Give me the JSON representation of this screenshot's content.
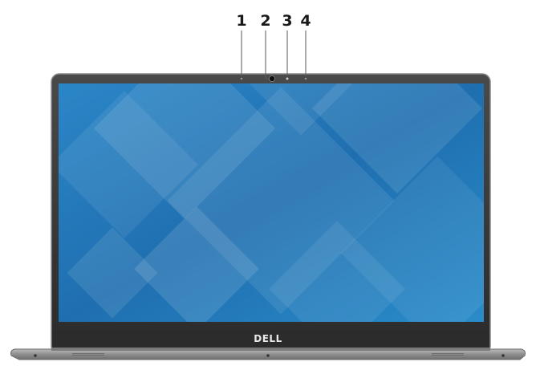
{
  "figure": {
    "title": "",
    "callouts": [
      {
        "number": "1"
      },
      {
        "number": "2"
      },
      {
        "number": "3"
      },
      {
        "number": "4"
      }
    ],
    "logo_text": "DELL"
  },
  "colors": {
    "bezel": "#3a3a3a",
    "screen_blue": "#1f7fc0",
    "base_silver": "#9a9a9a",
    "callout_line": "#5a5a5a"
  }
}
